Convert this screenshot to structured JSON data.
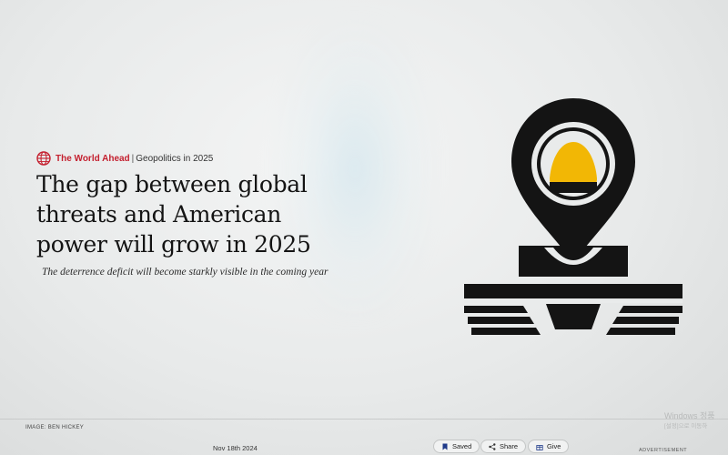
{
  "article": {
    "section": "The World Ahead",
    "separator": "|",
    "topic": "Geopolitics in 2025",
    "headline": "The gap between global threats and American power will grow in 2025",
    "dek": "The deterrence deficit will become starkly visible in the coming year",
    "image_credit": "IMAGE: BEN HICKEY",
    "date": "Nov 18th 2024"
  },
  "actions": {
    "saved": "Saved",
    "share": "Share",
    "give": "Give"
  },
  "advertisement_label": "ADVERTISEMENT",
  "system_watermark": {
    "line1": "Windows 정품",
    "line2": "[설정]으로 이동하"
  },
  "icons": {
    "kicker": "globe-icon",
    "saved": "bookmark-icon",
    "share": "share-icon",
    "give": "gift-icon"
  },
  "colors": {
    "section_red": "#c4202f",
    "illustration_black": "#141414",
    "illustration_yellow": "#f2b705"
  }
}
